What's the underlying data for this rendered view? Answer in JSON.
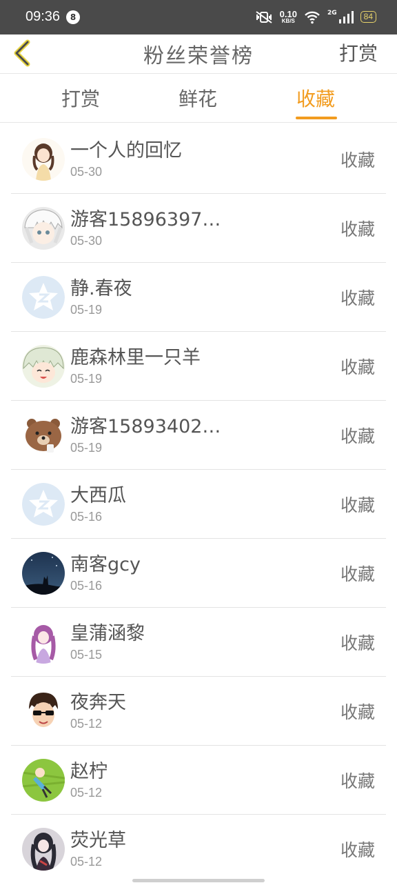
{
  "status_bar": {
    "time": "09:36",
    "notification_count": "8",
    "net_speed_value": "0.10",
    "net_speed_unit": "KB/S",
    "network_type": "2G",
    "battery": "84"
  },
  "header": {
    "back_icon": "chevron-left-icon",
    "title": "粉丝荣誉榜",
    "action": "打赏"
  },
  "tabs": [
    {
      "label": "打赏",
      "active": false
    },
    {
      "label": "鲜花",
      "active": false
    },
    {
      "label": "收藏",
      "active": true
    }
  ],
  "colors": {
    "accent": "#f29c1f",
    "status_bar": "#4a4a4a"
  },
  "list": [
    {
      "name": "一个人的回忆",
      "date": "05-30",
      "action": "收藏",
      "avatar": "anime-girl-avatar"
    },
    {
      "name": "游客15896397…",
      "date": "05-30",
      "action": "收藏",
      "avatar": "white-hair-boy-avatar"
    },
    {
      "name": "静.春夜",
      "date": "05-19",
      "action": "收藏",
      "avatar": "default-star-avatar"
    },
    {
      "name": "鹿森林里一只羊",
      "date": "05-19",
      "action": "收藏",
      "avatar": "laughing-anime-avatar"
    },
    {
      "name": "游客15893402…",
      "date": "05-19",
      "action": "收藏",
      "avatar": "brown-bear-avatar"
    },
    {
      "name": "大西瓜",
      "date": "05-16",
      "action": "收藏",
      "avatar": "default-star-avatar"
    },
    {
      "name": "南客gcy",
      "date": "05-16",
      "action": "收藏",
      "avatar": "night-wolf-avatar"
    },
    {
      "name": "皇蒲涵黎",
      "date": "05-15",
      "action": "收藏",
      "avatar": "purple-anime-avatar"
    },
    {
      "name": "夜奔天",
      "date": "05-12",
      "action": "收藏",
      "avatar": "sunglasses-boy-avatar"
    },
    {
      "name": "赵柠",
      "date": "05-12",
      "action": "收藏",
      "avatar": "green-lawn-avatar"
    },
    {
      "name": "荧光草",
      "date": "05-12",
      "action": "收藏",
      "avatar": "dark-anime-avatar"
    }
  ]
}
